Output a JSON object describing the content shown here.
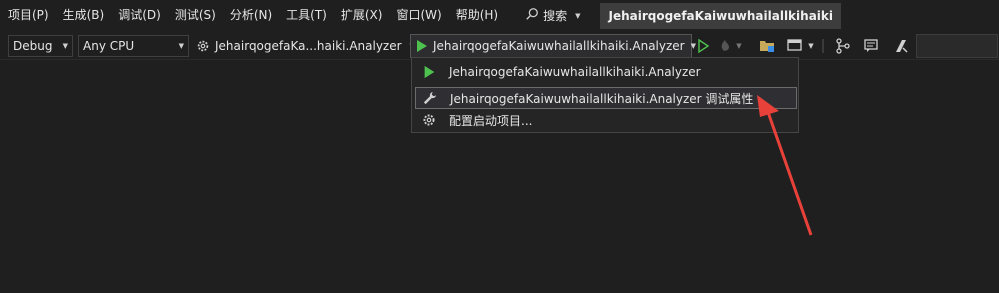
{
  "menubar": {
    "items": [
      "项目(P)",
      "生成(B)",
      "调试(D)",
      "测试(S)",
      "分析(N)",
      "工具(T)",
      "扩展(X)",
      "窗口(W)",
      "帮助(H)"
    ],
    "search_label": "搜索",
    "solution_title": "JehairqogefaKaiwuwhailallkihaiki"
  },
  "toolbar": {
    "configuration": "Debug",
    "platform": "Any CPU",
    "project": "JehairqogefaKa...haiki.Analyzer",
    "startup": "JehairqogefaKaiwuwhailallkihaiki.Analyzer"
  },
  "dropdown": {
    "items": [
      {
        "label": "JehairqogefaKaiwuwhailallkihaiki.Analyzer",
        "icon": "play-icon"
      },
      {
        "label": "JehairqogefaKaiwuwhailallkihaiki.Analyzer 调试属性",
        "icon": "wrench-icon"
      },
      {
        "label": "配置启动项目...",
        "icon": "gear-icon"
      }
    ]
  },
  "colors": {
    "background": "#1f1f1f",
    "play_green": "#4fc14f",
    "annotation_arrow": "#e8413a"
  }
}
